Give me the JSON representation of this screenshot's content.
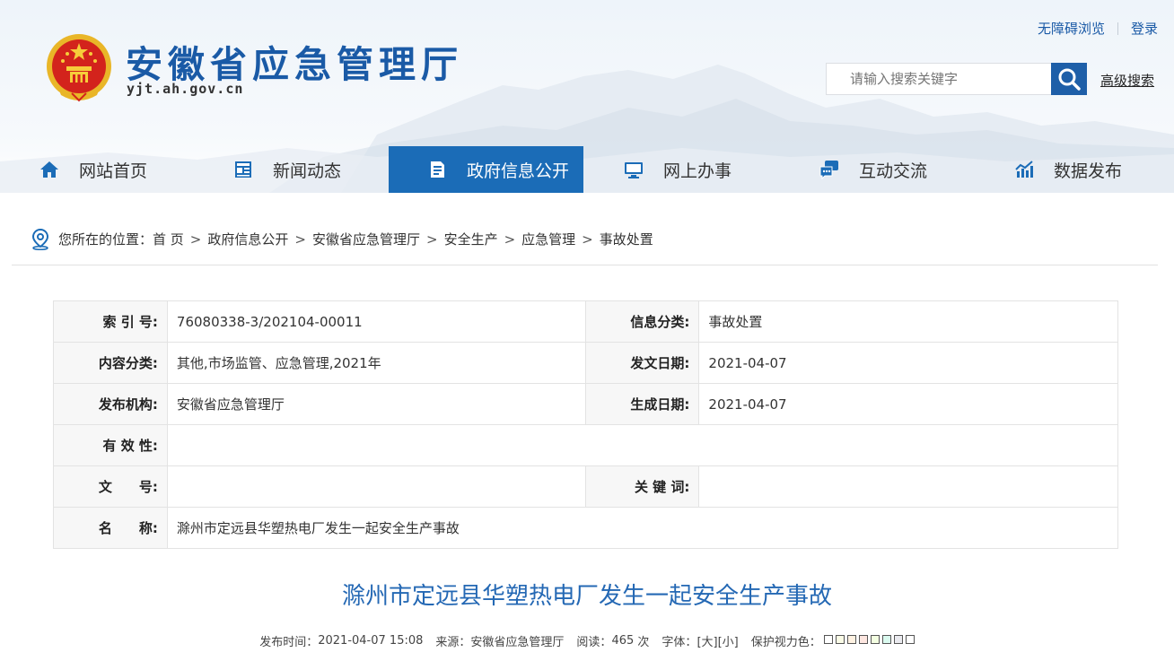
{
  "header": {
    "site_title": "安徽省应急管理厅",
    "site_domain": "yjt.ah.gov.cn",
    "toplinks": {
      "accessible": "无障碍浏览",
      "login": "登录"
    },
    "search": {
      "placeholder": "请输入搜索关键字",
      "advanced": "高级搜索"
    }
  },
  "nav": {
    "items": [
      {
        "label": "网站首页",
        "icon": "home-icon"
      },
      {
        "label": "新闻动态",
        "icon": "news-icon"
      },
      {
        "label": "政府信息公开",
        "icon": "document-icon",
        "active": true
      },
      {
        "label": "网上办事",
        "icon": "monitor-icon"
      },
      {
        "label": "互动交流",
        "icon": "chat-icon"
      },
      {
        "label": "数据发布",
        "icon": "chart-icon"
      }
    ],
    "active_color": "#1b6cb7"
  },
  "breadcrumb": {
    "prefix": "您所在的位置：",
    "items": [
      "首 页",
      "政府信息公开",
      "安徽省应急管理厅",
      "安全生产",
      "应急管理",
      "事故处置"
    ]
  },
  "info_table": {
    "index_label": "索 引 号:",
    "index_value": "76080338-3/202104-00011",
    "category_label": "信息分类:",
    "category_value": "事故处置",
    "content_label": "内容分类:",
    "content_value": "其他,市场监管、应急管理,2021年",
    "issue_date_label": "发文日期:",
    "issue_date_value": "2021-04-07",
    "publisher_label": "发布机构:",
    "publisher_value": "安徽省应急管理厅",
    "gen_date_label": "生成日期:",
    "gen_date_value": "2021-04-07",
    "validity_label": "有 效 性:",
    "validity_value": "",
    "doc_no_label": "文　　号:",
    "doc_no_value": "",
    "keywords_label": "关 键 词:",
    "keywords_value": "",
    "name_label": "名　　称:",
    "name_value": "滁州市定远县华塑热电厂发生一起安全生产事故"
  },
  "article": {
    "title": "滁州市定远县华塑热电厂发生一起安全生产事故",
    "meta": {
      "publish_time_label": "发布时间：",
      "publish_time": "2021-04-07 15:08",
      "source_label": "来源：",
      "source": "安徽省应急管理厅",
      "views_label": "阅读：",
      "views": "465",
      "views_unit": "次",
      "font_label": "字体：",
      "font_large": "[大]",
      "font_small": "[小]",
      "eye_label": "保护视力色：",
      "eye_colors": [
        "#ffffff",
        "#fafbe6",
        "#fff2e2",
        "#fde6e0",
        "#f3ffe1",
        "#dafaef",
        "#eaeaef",
        "#ffffff"
      ]
    }
  }
}
